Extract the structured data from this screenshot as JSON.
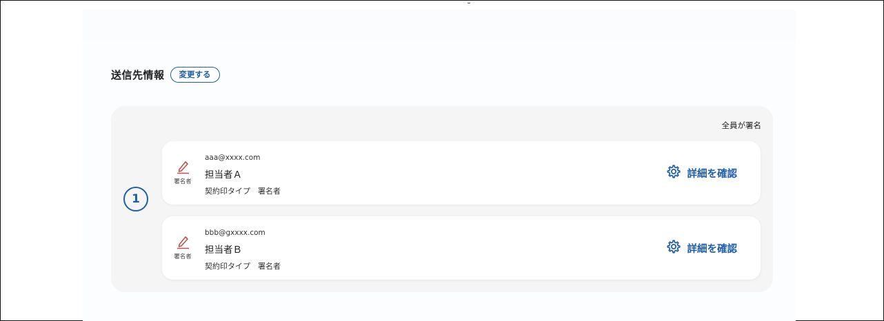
{
  "section": {
    "title": "送信先情報",
    "change_label": "変更する"
  },
  "group": {
    "order": "1",
    "mode": "全員が署名",
    "recipients": [
      {
        "email": "aaa@xxxx.com",
        "name": "担当者Ａ",
        "stamp": "契約印タイプ　署名者",
        "role": "署名者",
        "role_icon": "pen-icon",
        "detail_label": "詳細を確認",
        "detail_icon": "gear-icon"
      },
      {
        "email": "bbb@gxxxx.com",
        "name": "担当者Ｂ",
        "stamp": "契約印タイプ　署名者",
        "role": "署名者",
        "role_icon": "pen-icon",
        "detail_label": "詳細を確認",
        "detail_icon": "gear-icon"
      }
    ]
  },
  "colors": {
    "accent": "#1e5fa8",
    "signer_icon": "#c0504d",
    "group_bg": "#f5f5f6"
  }
}
